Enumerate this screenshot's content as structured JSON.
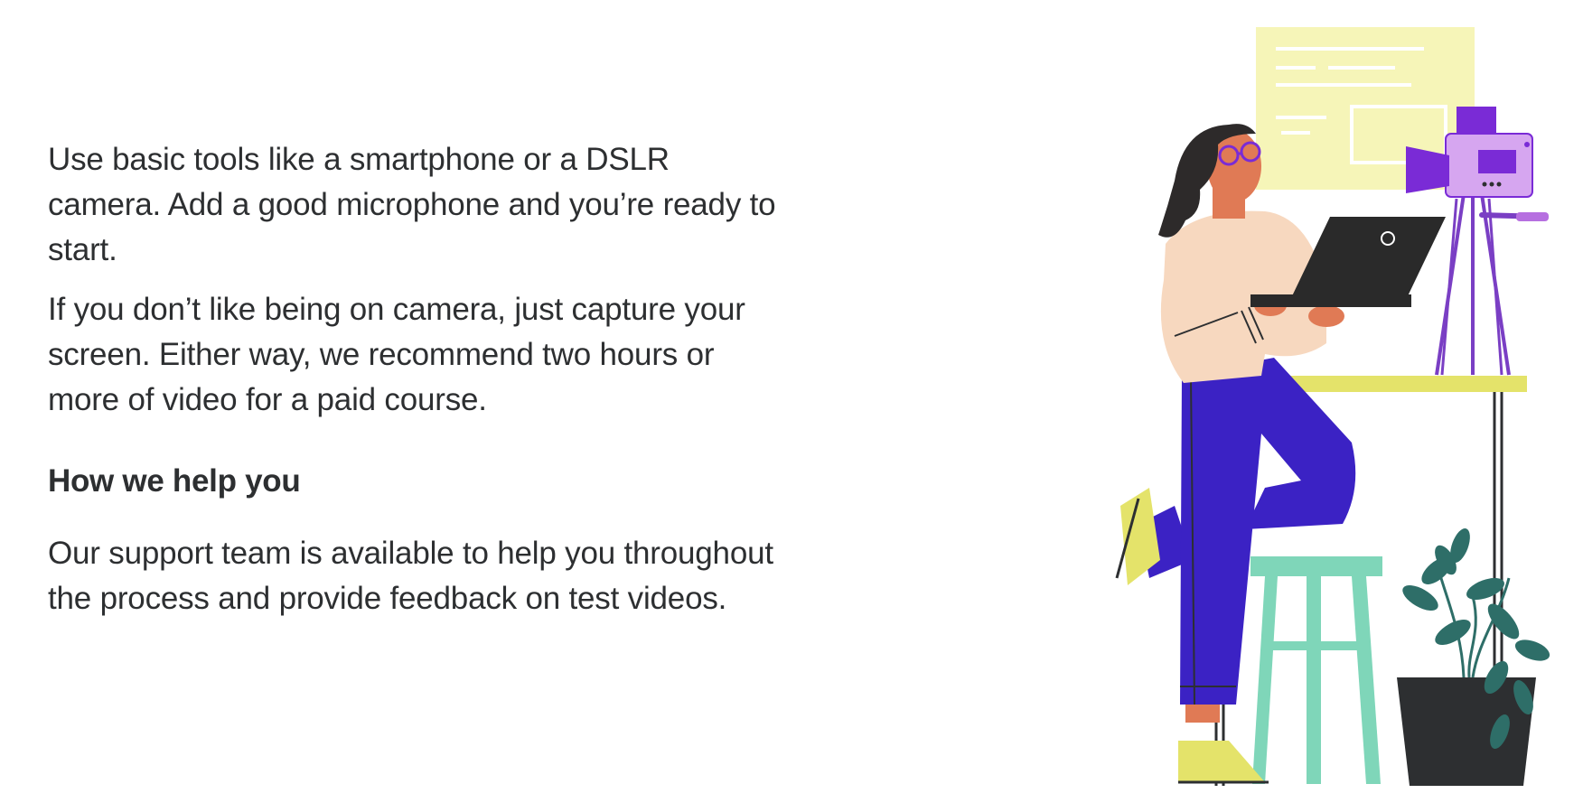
{
  "content": {
    "paragraph_1": "Use basic tools like a smartphone or a DSLR camera. Add a good microphone and you’re ready to start.",
    "paragraph_2": "If you don’t like being on camera, just capture your screen. Either way, we recommend two hours or more of video for a paid course.",
    "heading": "How we help you",
    "paragraph_3": "Our support team is available to help you throughout the process and provide feedback on test videos."
  },
  "illustration": {
    "subject": "person-with-laptop-recording-video",
    "colors": {
      "wall_panel": "#f6f5b8",
      "camera": "#d6a6f0",
      "camera_dark": "#7a2bd6",
      "tripod": "#7a3fc4",
      "skin": "#e07a55",
      "hair": "#2d2a2a",
      "sweater": "#f7d8bf",
      "pants": "#3b22c4",
      "table": "#e4e36a",
      "stool": "#7fd6b9",
      "shoes": "#e4e36a",
      "plant": "#2e6e68",
      "pot": "#2d2f31",
      "laptop": "#2a2a2a"
    }
  }
}
